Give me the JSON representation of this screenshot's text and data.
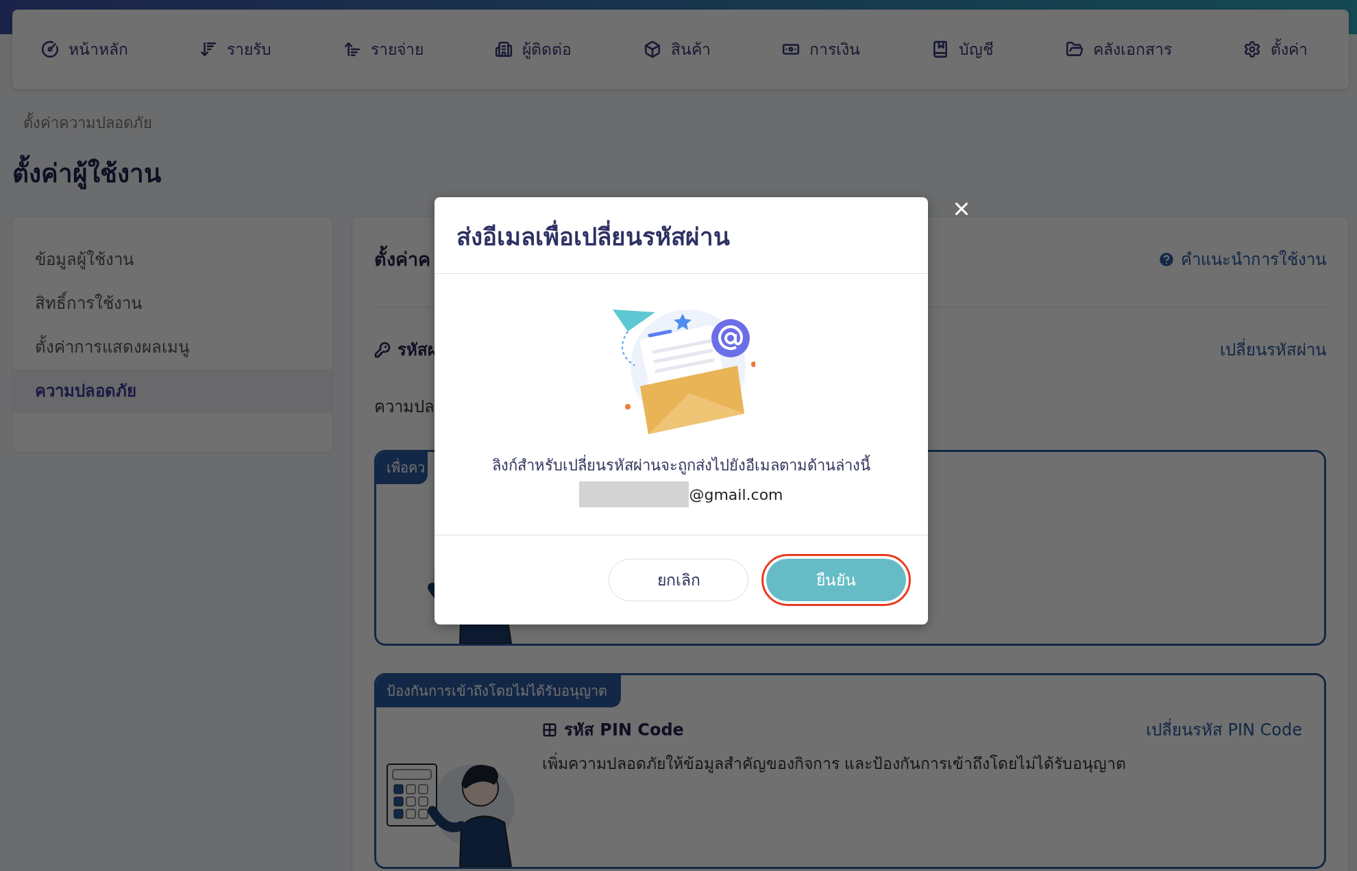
{
  "nav": [
    "หน้าหลัก",
    "รายรับ",
    "รายจ่าย",
    "ผู้ติดต่อ",
    "สินค้า",
    "การเงิน",
    "บัญชี",
    "คลังเอกสาร",
    "ตั้งค่า"
  ],
  "breadcrumb": "ตั้งค่าความปลอดภัย",
  "page_title": "ตั้งค่าผู้ใช้งาน",
  "sidebar": {
    "items": [
      {
        "label": "ข้อมูลผู้ใช้งาน",
        "selected": false
      },
      {
        "label": "สิทธิ์การใช้งาน",
        "selected": false
      },
      {
        "label": "ตั้งค่าการแสดงผลเมนู",
        "selected": false
      },
      {
        "label": "ความปลอดภัย",
        "selected": true
      }
    ]
  },
  "content": {
    "heading": "ตั้งค่าค",
    "help_link": "คำแนะนำการใช้งาน",
    "password_label": "รหัสผ",
    "password_link": "เปลี่ยนรหัสผ่าน",
    "section_text": "ความปล",
    "cards": [
      {
        "tag": "เพื่อคว"
      },
      {
        "tag": "ป้องกันการเข้าถึงโดยไม่ได้รับอนุญาต",
        "title": "รหัส PIN Code",
        "link": "เปลี่ยนรหัส PIN Code",
        "description": "เพิ่มความปลอดภัยให้ข้อมูลสำคัญของกิจการ และป้องกันการเข้าถึงโดยไม่ได้รับอนุญาต"
      }
    ]
  },
  "modal": {
    "title": "ส่งอีเมลเพื่อเปลี่ยนรหัสผ่าน",
    "message": "ลิงก์สำหรับเปลี่ยนรหัสผ่านจะถูกส่งไปยังอีเมลตามด้านล่างนี้",
    "email": "@gmail.com",
    "buttons": [
      {
        "label": "ยกเลิก",
        "kind": "secondary",
        "highlighted": false
      },
      {
        "label": "ยืนยัน",
        "kind": "primary",
        "highlighted": true
      }
    ]
  }
}
